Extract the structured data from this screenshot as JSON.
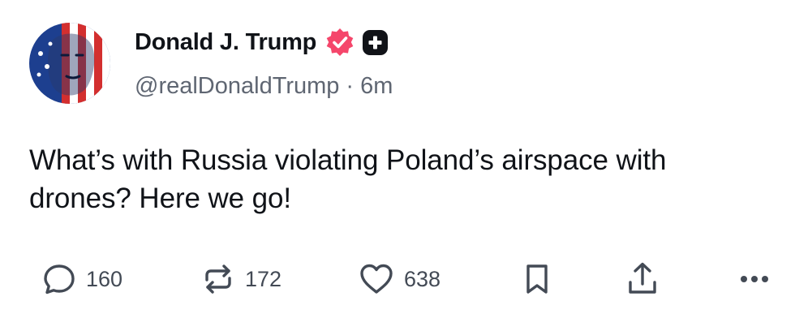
{
  "author": {
    "display_name": "Donald J. Trump",
    "handle": "@realDonaldTrump",
    "separator": "·",
    "timestamp": "6m",
    "verified_icon": "verified-badge-icon",
    "plus_icon": "plus-badge-icon",
    "verified_color": "#f5466b"
  },
  "post": {
    "text": "What’s with Russia violating Poland’s airspace with drones? Here we go!"
  },
  "actions": {
    "replies": {
      "icon": "comment-icon",
      "count": "160"
    },
    "reposts": {
      "icon": "repost-icon",
      "count": "172"
    },
    "likes": {
      "icon": "heart-icon",
      "count": "638"
    },
    "bookmark": {
      "icon": "bookmark-icon"
    },
    "share": {
      "icon": "share-icon"
    },
    "more": {
      "icon": "more-icon"
    }
  },
  "colors": {
    "text": "#101318",
    "secondary": "#5f6672",
    "icon": "#434a55"
  }
}
